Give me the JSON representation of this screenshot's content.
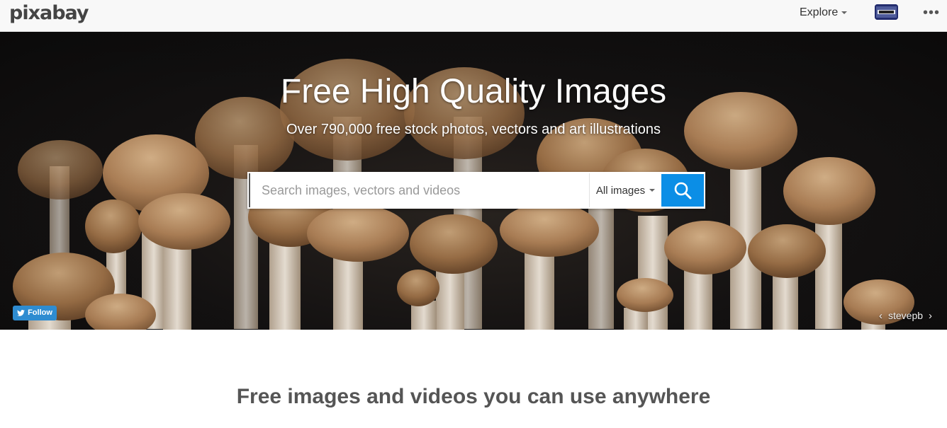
{
  "header": {
    "logo": "pixabay",
    "explore_label": "Explore",
    "more_label": "•••"
  },
  "hero": {
    "title": "Free High Quality Images",
    "subtitle": "Over 790,000 free stock photos, vectors and art illustrations",
    "search_placeholder": "Search images, vectors and videos",
    "search_value": "",
    "type_selected": "All images",
    "follow_label": "Follow",
    "photo_credit": "stevepb"
  },
  "main": {
    "tagline": "Free images and videos you can use anywhere"
  },
  "colors": {
    "accent": "#0b8ee6",
    "twitter": "#2e8cd1",
    "header_bg": "#f8f8f8"
  }
}
